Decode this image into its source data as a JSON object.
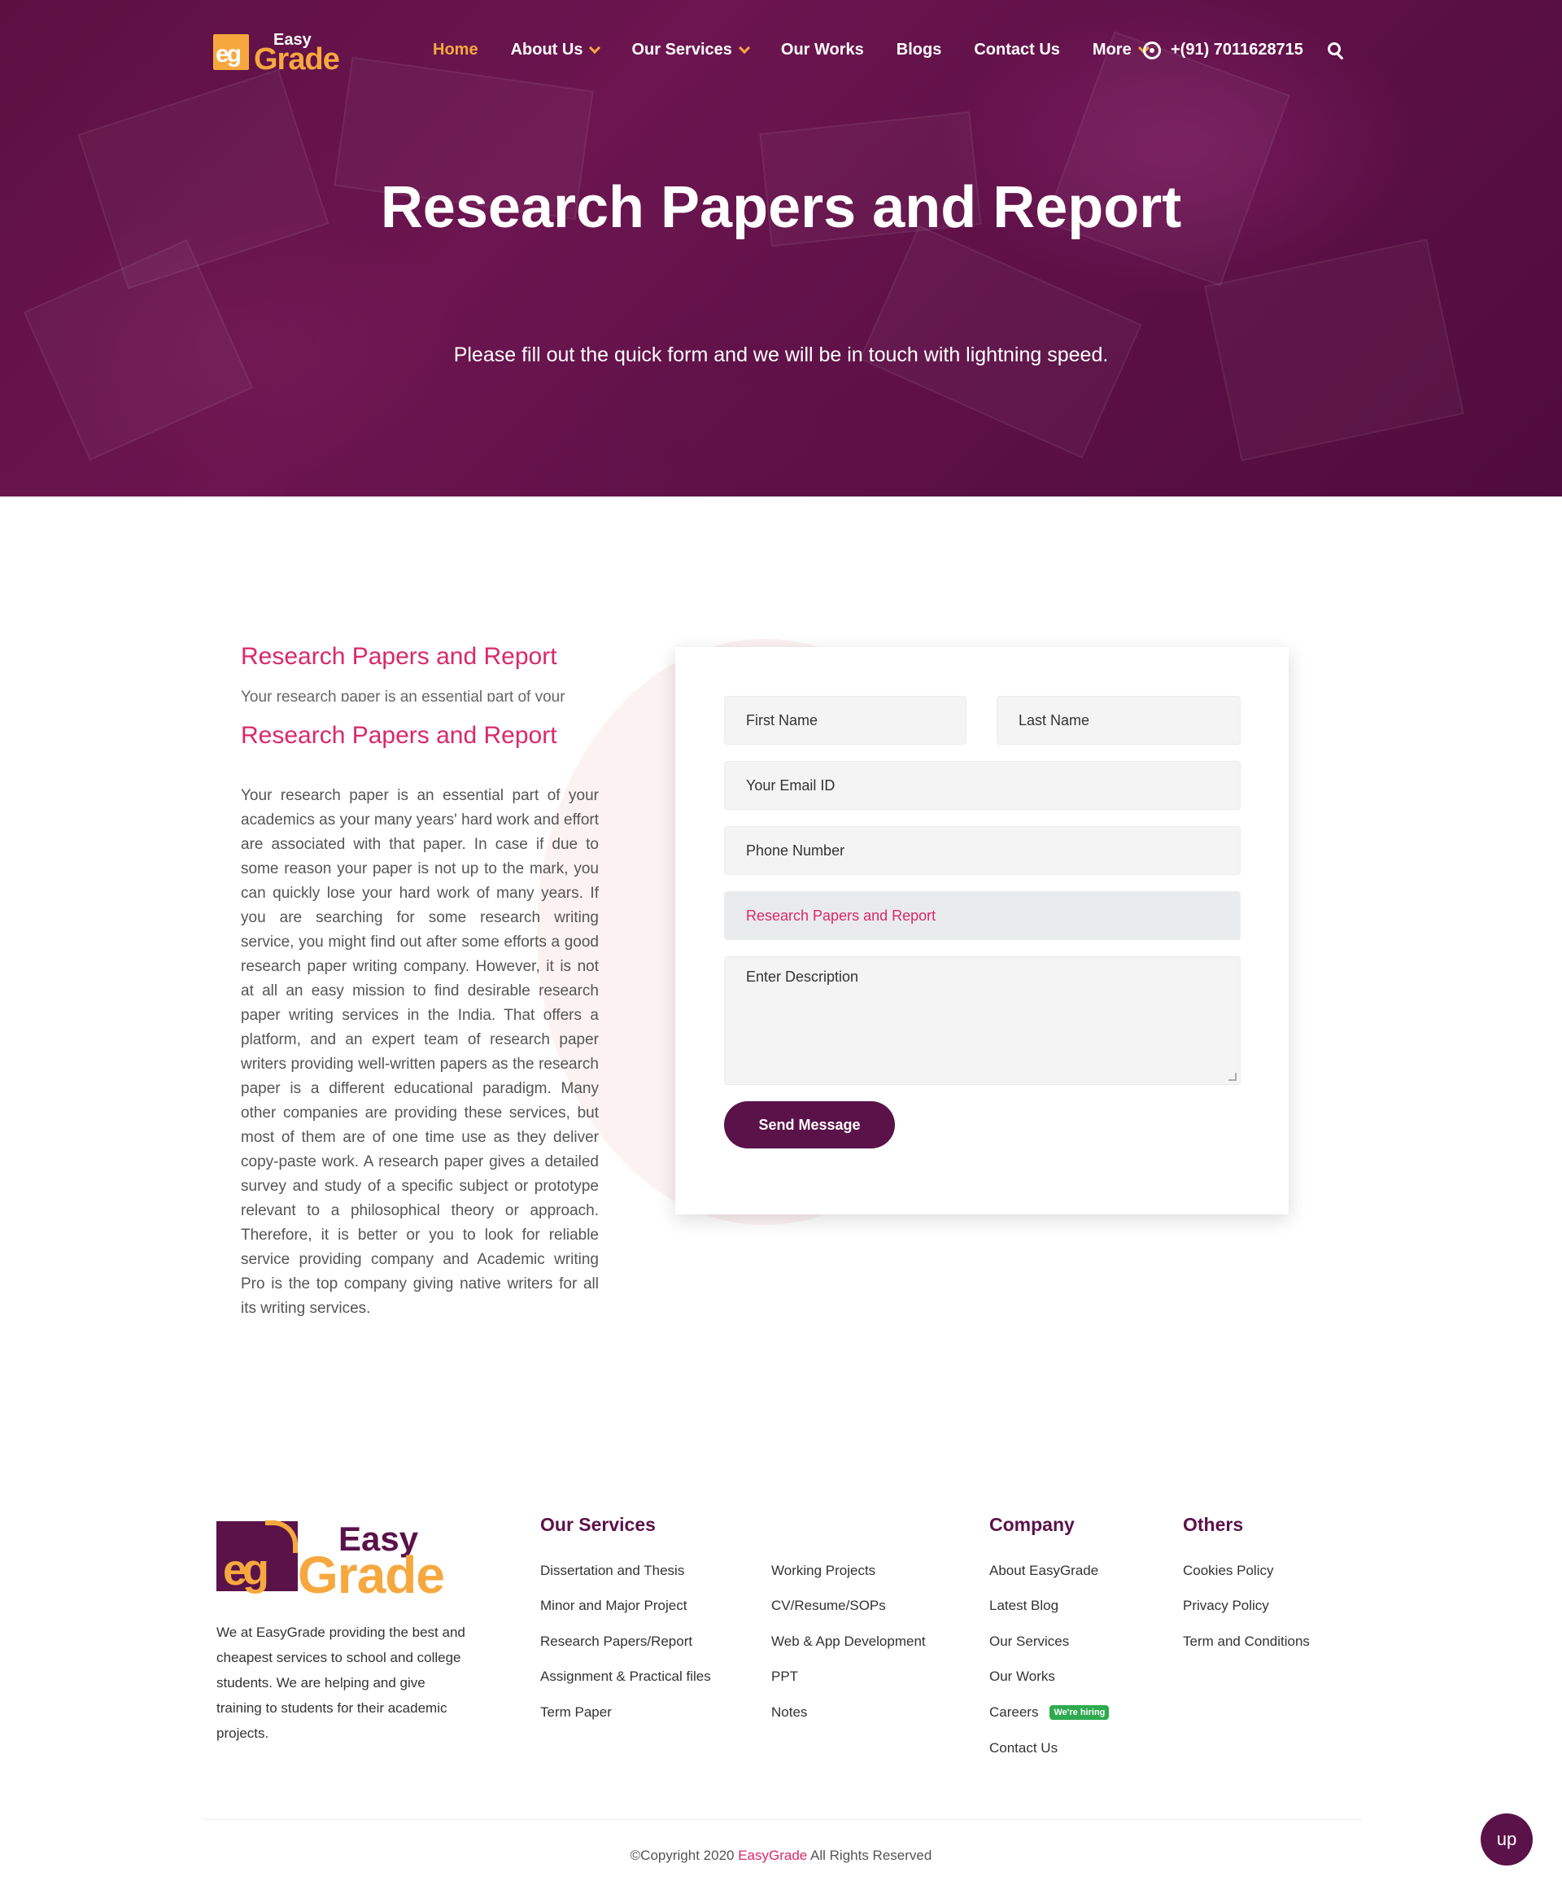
{
  "nav": {
    "logo": {
      "small": "eg",
      "easy": "Easy",
      "grade": "Grade"
    },
    "items": [
      {
        "label": "Home",
        "active": true,
        "dropdown": false
      },
      {
        "label": "About Us",
        "active": false,
        "dropdown": true
      },
      {
        "label": "Our Services",
        "active": false,
        "dropdown": true
      },
      {
        "label": "Our Works",
        "active": false,
        "dropdown": false
      },
      {
        "label": "Blogs",
        "active": false,
        "dropdown": false
      },
      {
        "label": "Contact Us",
        "active": false,
        "dropdown": false
      },
      {
        "label": "More",
        "active": false,
        "dropdown": true
      }
    ],
    "phone": "+(91) 7011628715",
    "icons": {
      "phone": "whatsapp-icon",
      "search": "search-icon"
    }
  },
  "hero": {
    "title": "Research Papers and Report",
    "subtitle": "Please fill out the quick form and we will be in touch with lightning speed."
  },
  "content": {
    "heading_1": "Research Papers and Report",
    "ghost_text": "Your research paper is an essential part of your",
    "heading_2": "Research Papers and Report",
    "body": "Your research paper is an essential part of your academics as your many years' hard work and effort are associated with that paper. In case if due to some reason your paper is not up to the mark, you can quickly lose your hard work of many years. If you are searching for some research writing service, you might find out after some efforts a good research paper writing company. However, it is not at all an easy mission to find desirable research paper writing services in the India. That offers a platform, and an expert team of research paper writers providing well-written papers as the research paper is a different educational paradigm. Many other companies are providing these services, but most of them are of one time use as they deliver copy-paste work. A research paper gives a detailed survey and study of a specific subject or prototype relevant to a philosophical theory or approach. Therefore, it is better or you to look for reliable service providing company and Academic writing Pro is the top company giving native writers for all its writing services."
  },
  "form": {
    "first_name": "First Name",
    "last_name": "Last Name",
    "email": "Your Email ID",
    "phone": "Phone Number",
    "service": "Research Papers and Report",
    "description": "Enter Description",
    "submit": "Send Message"
  },
  "footer": {
    "logo": {
      "small": "eg",
      "easy": "Easy",
      "grade": "Grade"
    },
    "description": "We at EasyGrade providing the best and cheapest services to school and college students. We are helping and give training to students for their academic projects.",
    "services_heading": "Our Services",
    "services_col1": [
      "Dissertation and Thesis",
      "Minor and Major Project",
      "Research Papers/Report",
      "Assignment & Practical files",
      "Term Paper"
    ],
    "services_col2": [
      "Working Projects",
      "CV/Resume/SOPs",
      "Web & App Development",
      "PPT",
      "Notes"
    ],
    "company_heading": "Company",
    "company": [
      "About EasyGrade",
      "Latest Blog",
      "Our Services",
      "Our Works",
      "Careers",
      "Contact Us"
    ],
    "hiring_badge": "We're hiring",
    "others_heading": "Others",
    "others": [
      "Cookies Policy",
      "Privacy Policy",
      "Term and Conditions"
    ],
    "copyright_prefix": "©Copyright 2020 ",
    "copyright_brand": "EasyGrade",
    "copyright_suffix": " All Rights Reserved",
    "up_button": "up"
  },
  "colors": {
    "brand_purple": "#5a1249",
    "accent_orange": "#f6a83f",
    "accent_pink": "#d9296a",
    "hiring_green": "#2eaa4f"
  }
}
